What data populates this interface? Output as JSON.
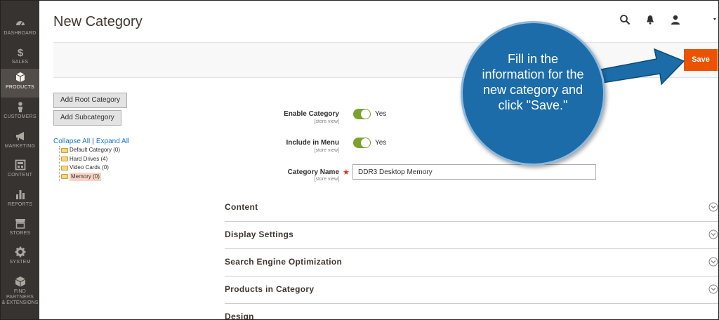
{
  "sidebar": {
    "items": [
      {
        "label": "DASHBOARD",
        "icon": "dashboard-icon"
      },
      {
        "label": "SALES",
        "icon": "dollar-icon"
      },
      {
        "label": "PRODUCTS",
        "icon": "cube-icon",
        "active": true
      },
      {
        "label": "CUSTOMERS",
        "icon": "person-icon"
      },
      {
        "label": "MARKETING",
        "icon": "megaphone-icon"
      },
      {
        "label": "CONTENT",
        "icon": "layout-icon"
      },
      {
        "label": "REPORTS",
        "icon": "bar-chart-icon"
      },
      {
        "label": "STORES",
        "icon": "storefront-icon"
      },
      {
        "label": "SYSTEM",
        "icon": "gear-icon"
      },
      {
        "label": "FIND PARTNERS",
        "label2": "& EXTENSIONS",
        "icon": "box-icon"
      }
    ]
  },
  "header": {
    "title": "New Category",
    "icons": [
      "search-icon",
      "bell-icon",
      "user-icon",
      "caret-down-icon"
    ]
  },
  "actions": {
    "save_label": "Save",
    "save_color": "#eb5202"
  },
  "tree_panel": {
    "add_root_label": "Add Root Category",
    "add_sub_label": "Add Subcategory",
    "collapse_all": "Collapse All",
    "separator": "|",
    "expand_all": "Expand All",
    "nodes": [
      {
        "label": "Default Category (0)"
      },
      {
        "label": "Hard Drives (4)"
      },
      {
        "label": "Video Cards (0)"
      },
      {
        "label": "Memory (0)",
        "selected": true
      }
    ]
  },
  "form": {
    "enable_category": {
      "label": "Enable Category",
      "scope": "[store view]",
      "value": "Yes"
    },
    "include_in_menu": {
      "label": "Include in Menu",
      "scope": "[store view]",
      "value": "Yes"
    },
    "category_name": {
      "label": "Category Name",
      "scope": "[store view]",
      "required_mark": "★",
      "value": "DDR3 Desktop Memory"
    }
  },
  "sections": [
    {
      "title": "Content"
    },
    {
      "title": "Display Settings"
    },
    {
      "title": "Search Engine Optimization"
    },
    {
      "title": "Products in Category"
    },
    {
      "title": "Design"
    }
  ],
  "callout": {
    "text_line1": "Fill in the",
    "text_line2": "information for the",
    "text_line3": "new category and",
    "text_line4": "click \"Save.\"",
    "color": "#1b6ca8"
  },
  "colors": {
    "sidebar_bg": "#373330",
    "toggle_on": "#79a22e",
    "link": "#1979c3"
  }
}
